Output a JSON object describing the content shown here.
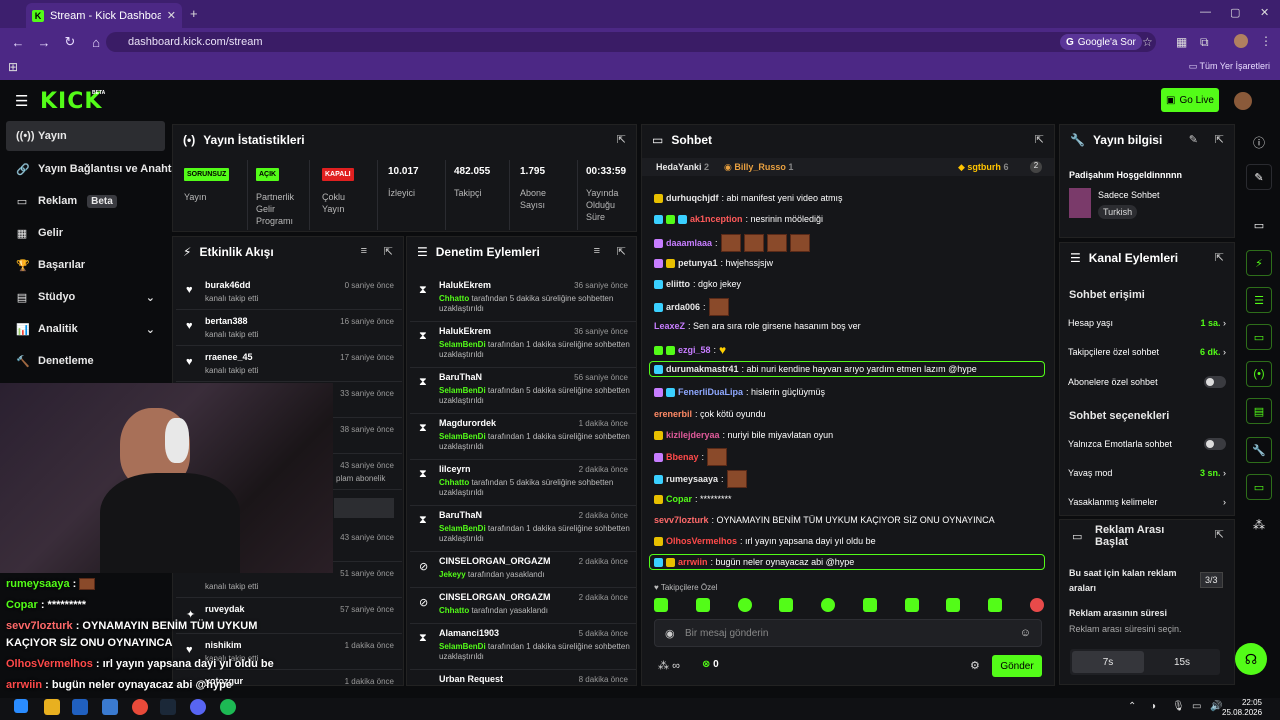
{
  "browser": {
    "tab_title": "Stream - Kick Dashboard",
    "url": "dashboard.kick.com/stream",
    "google_button": "Google'a Sor",
    "bookmarks_label": "Tüm Yer İşaretleri"
  },
  "header": {
    "logo": "KICK",
    "beta": "BETA",
    "go_live": "Go Live"
  },
  "sidebar": {
    "items": [
      {
        "label": "Yayın",
        "icon": "broadcast-icon"
      },
      {
        "label": "Yayın Bağlantısı ve Anahtar",
        "icon": "link-icon"
      },
      {
        "label": "Reklam",
        "icon": "ad-icon",
        "badge": "Beta"
      },
      {
        "label": "Gelir",
        "icon": "income-icon"
      },
      {
        "label": "Başarılar",
        "icon": "trophy-icon"
      },
      {
        "label": "Stüdyo",
        "icon": "studio-icon"
      },
      {
        "label": "Analitik",
        "icon": "analytics-icon"
      },
      {
        "label": "Denetleme",
        "icon": "hammer-icon"
      }
    ]
  },
  "stats": {
    "title": "Yayın İstatistikleri",
    "items": [
      {
        "tag": "SORUNSUZ",
        "label": "Yayın"
      },
      {
        "tag": "AÇIK",
        "label": "Partnerlik Gelir Programı"
      },
      {
        "tag": "KAPALI",
        "label": "Çoklu Yayın"
      },
      {
        "value": "10.017",
        "label": "İzleyici"
      },
      {
        "value": "482.055",
        "label": "Takipçi"
      },
      {
        "value": "1.795",
        "label": "Abone Sayısı"
      },
      {
        "value": "00:33:59",
        "label": "Yayında Olduğu Süre"
      }
    ]
  },
  "activity": {
    "title": "Etkinlik Akışı",
    "items": [
      {
        "name": "burak46dd",
        "desc": "kanalı takip etti",
        "time": "0 saniye önce"
      },
      {
        "name": "bertan388",
        "desc": "kanalı takip etti",
        "time": "16 saniye önce"
      },
      {
        "name": "rraenee_45",
        "desc": "kanalı takip etti",
        "time": "17 saniye önce"
      },
      {
        "name": "",
        "desc": "",
        "time": "33 saniye önce"
      },
      {
        "name": "",
        "desc": "",
        "time": "38 saniye önce"
      },
      {
        "name": "",
        "desc": "plam abonelik",
        "time": "43 saniye önce"
      },
      {
        "name": "",
        "desc": "",
        "time": "43 saniye önce"
      },
      {
        "name": "",
        "desc": "kanalı takip etti",
        "time": "51 saniye önce"
      },
      {
        "name": "ruveydak",
        "desc": "",
        "time": "57 saniye önce"
      },
      {
        "name": "nishikim",
        "desc": "kanalı takip etti",
        "time": "1 dakika önce"
      },
      {
        "name": "yotozgur",
        "desc": "",
        "time": "1 dakika önce"
      }
    ]
  },
  "moderation": {
    "title": "Denetim Eylemleri",
    "items": [
      {
        "name": "HalukEkrem",
        "mod": "Chhatto",
        "desc": " tarafından 5 dakika süreliğine sohbetten uzaklaştırıldı",
        "time": "36 saniye önce",
        "icon": "hourglass-icon"
      },
      {
        "name": "HalukEkrem",
        "mod": "SelamBenDi",
        "desc": " tarafından 1 dakika süreliğine sohbetten uzaklaştırıldı",
        "time": "36 saniye önce",
        "icon": "hourglass-icon"
      },
      {
        "name": "BaruThaN",
        "mod": "SelamBenDi",
        "desc": " tarafından 5 dakika süreliğine sohbetten uzaklaştırıldı",
        "time": "56 saniye önce",
        "icon": "hourglass-icon"
      },
      {
        "name": "Magdurordek",
        "mod": "SelamBenDi",
        "desc": " tarafından 1 dakika süreliğine sohbetten uzaklaştırıldı",
        "time": "1 dakika önce",
        "icon": "hourglass-icon"
      },
      {
        "name": "lilceyrn",
        "mod": "Chhatto",
        "desc": " tarafından 5 dakika süreliğine sohbetten uzaklaştırıldı",
        "time": "2 dakika önce",
        "icon": "hourglass-icon"
      },
      {
        "name": "BaruThaN",
        "mod": "SelamBenDi",
        "desc": " tarafından 1 dakika süreliğine sohbetten uzaklaştırıldı",
        "time": "2 dakika önce",
        "icon": "hourglass-icon"
      },
      {
        "name": "CINSELORGAN_ORGAZM",
        "mod": "Jekeyy",
        "desc": " tarafından yasaklandı",
        "time": "2 dakika önce",
        "icon": "ban-icon"
      },
      {
        "name": "CINSELORGAN_ORGAZM",
        "mod": "Chhatto",
        "desc": " tarafından yasaklandı",
        "time": "2 dakika önce",
        "icon": "ban-icon"
      },
      {
        "name": "Alamanci1903",
        "mod": "SelamBenDi",
        "desc": " tarafından 1 dakika süreliğine sohbetten uzaklaştırıldı",
        "time": "5 dakika önce",
        "icon": "hourglass-icon"
      },
      {
        "name": "Urban Request",
        "mod": "",
        "desc": "",
        "time": "8 dakika önce",
        "icon": "hourglass-icon"
      }
    ]
  },
  "chat": {
    "title": "Sohbet",
    "top": [
      {
        "name": "HedaYanki",
        "count": "2"
      },
      {
        "name": "Billy_Russo",
        "count": "1"
      },
      {
        "name": "sgtburh",
        "count": "6"
      }
    ],
    "messages": [
      {
        "user": "durhuqchjdf",
        "color": "#e8e8e8",
        "text": ": abi manifest yeni video atmış",
        "emotes": 0
      },
      {
        "user": "ak1nception",
        "color": "#ff5a5a",
        "text": ": nesrinin möölediği",
        "emotes": 0
      },
      {
        "user": "daaamlaaa",
        "color": "#c77dff",
        "text": ":",
        "emotes": 4
      },
      {
        "user": "petunya1",
        "color": "#e8e8e8",
        "text": ": hwjehssjsjw",
        "emotes": 0
      },
      {
        "user": "eliitto",
        "color": "#e8e8e8",
        "text": ": dgko jekey",
        "emotes": 0
      },
      {
        "user": "arda006",
        "color": "#e8e8e8",
        "text": ":",
        "emotes": 1
      },
      {
        "user": "LeaxeZ",
        "color": "#c77dff",
        "text": ": Sen ara sıra role girsene hasanım boş ver",
        "emotes": 0
      },
      {
        "user": "ezgi_58",
        "color": "#c77dff",
        "text": ":",
        "emotes": 0
      },
      {
        "user": "durumakmastr41",
        "color": "#e8e8e8",
        "text": ": abi nuri kendine hayvan arıyo yardım etmen lazım @hype",
        "emotes": 0
      },
      {
        "user": "FenerliDuaLipa",
        "color": "#8ea8ff",
        "text": ": hislerin güçlüymüş",
        "emotes": 0
      },
      {
        "user": "erenerbil",
        "color": "#ff8a65",
        "text": ": çok kötü oyundu",
        "emotes": 0
      },
      {
        "user": "kizilejderyaa",
        "color": "#e05a9a",
        "text": ": nuriyi bile miyavlatan oyun",
        "emotes": 0
      },
      {
        "user": "Bbenay",
        "color": "#ff4a4a",
        "text": ":",
        "emotes": 1
      },
      {
        "user": "rumeysaaya",
        "color": "#e8e8e8",
        "text": ":",
        "emotes": 1
      },
      {
        "user": "Copar",
        "color": "#53fc18",
        "text": ": *********",
        "emotes": 0
      },
      {
        "user": "sevv7lozturk",
        "color": "#ff6a6a",
        "text": ": OYNAMAYIN BENİM TÜM UYKUM KAÇIYOR SİZ ONU OYNAYINCA",
        "emotes": 0
      },
      {
        "user": "OlhosVermelhos",
        "color": "#ff4a4a",
        "text": ": ırl yayın yapsana dayi yıl oldu be",
        "emotes": 0
      },
      {
        "user": "arrwiin",
        "color": "#ff4a4a",
        "text": ": bugün neler oynayacaz abi @hype",
        "emotes": 0
      }
    ],
    "followers_only": "Takipçilere Özel",
    "placeholder": "Bir mesaj gönderin",
    "infinity": "∞",
    "points": "0",
    "send": "Gönder"
  },
  "stream_info": {
    "title": "Yayın bilgisi",
    "stream_title": "Padişahım Hoşgeldinnnnn",
    "category": "Sadece Sohbet",
    "language": "Turkish"
  },
  "channel_actions": {
    "title": "Kanal Eylemleri",
    "chat_access": "Sohbet erişimi",
    "account_age": {
      "label": "Hesap yaşı",
      "value": "1 sa."
    },
    "followers_only": {
      "label": "Takipçilere özel sohbet",
      "value": "6 dk."
    },
    "subs_only": {
      "label": "Abonelere özel sohbet"
    },
    "chat_options": "Sohbet seçenekleri",
    "emotes_only": {
      "label": "Yalnızca Emotlarla sohbet"
    },
    "slow_mode": {
      "label": "Yavaş mod",
      "value": "3 sn."
    },
    "banned_words": {
      "label": "Yasaklanmış kelimeler"
    }
  },
  "ad_break": {
    "title": "Reklam Arası Başlat",
    "remaining_label": "Bu saat için kalan reklam araları",
    "remaining_value": "3/3",
    "duration_label": "Reklam arasının süresi",
    "duration_hint": "Reklam arası süresini seçin.",
    "options": [
      "7s",
      "15s"
    ]
  },
  "overlay_chat": [
    {
      "user": "rumeysaaya",
      "text": " :",
      "color": "#e8e8e8"
    },
    {
      "user": "Copar",
      "text": " : *********",
      "color": "#53fc18"
    },
    {
      "user": "sevv7lozturk",
      "text": " : OYNAMAYIN BENİM TÜM UYKUM",
      "color": "#ff6a6a"
    },
    {
      "user": "",
      "text": "KAÇIYOR SİZ ONU OYNAYINCA",
      "color": "#fff"
    },
    {
      "user": "OlhosVermelhos",
      "text": " : ırl yayın yapsana dayi yıl oldu be",
      "color": "#ff4a4a"
    },
    {
      "user": "arrwiin",
      "text": " : bugün neler oynayacaz abi @hype",
      "color": "#ff4a4a"
    }
  ],
  "taskbar": {
    "time": "22:05",
    "date": "25.08.2026"
  }
}
